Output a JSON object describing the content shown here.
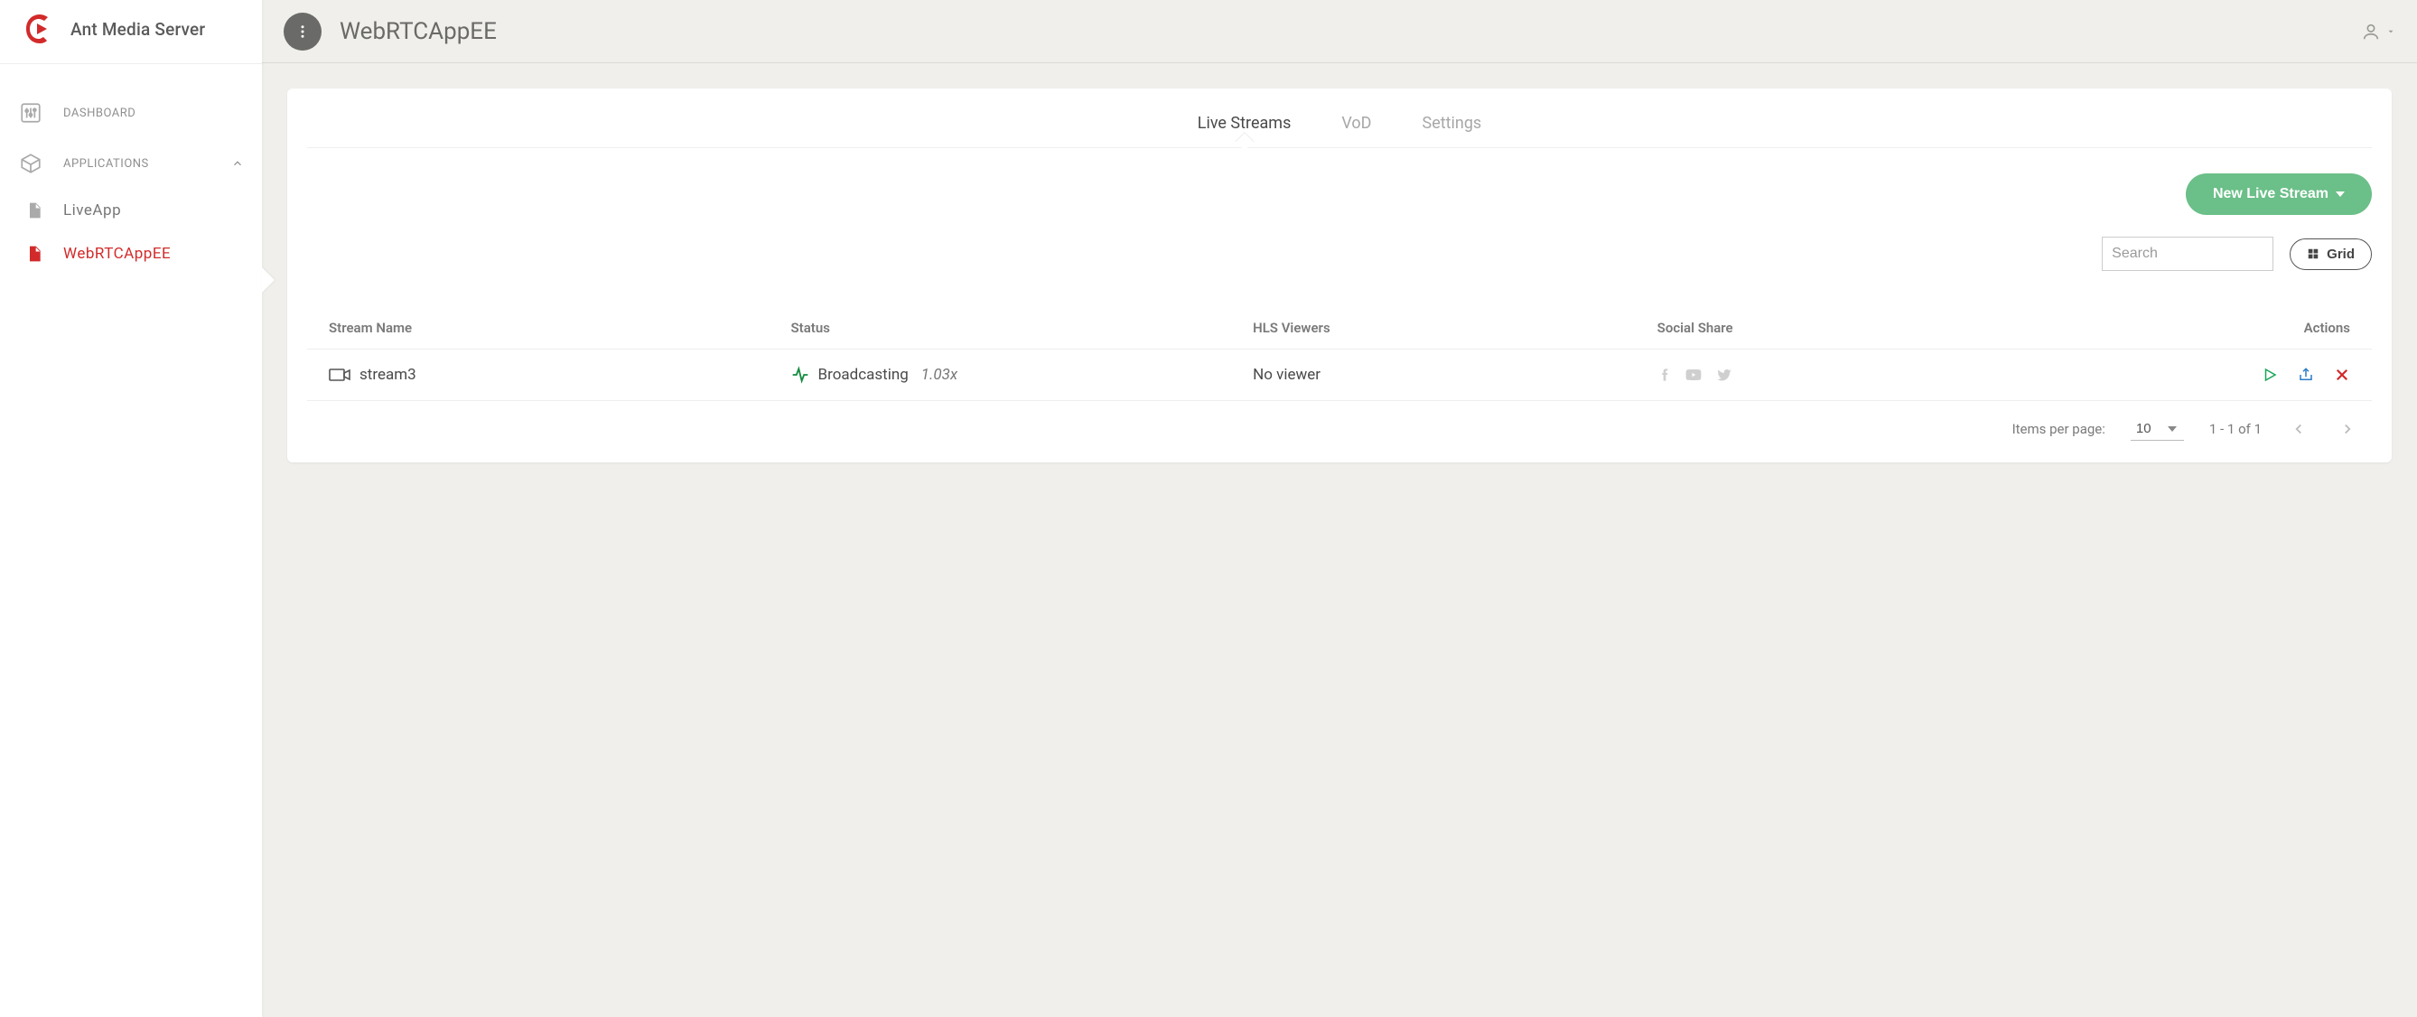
{
  "brand": {
    "title": "Ant Media Server"
  },
  "sidebar": {
    "dashboard_label": "DASHBOARD",
    "applications_label": "APPLICATIONS",
    "apps": [
      {
        "label": "LiveApp"
      },
      {
        "label": "WebRTCAppEE"
      }
    ]
  },
  "header": {
    "page_title": "WebRTCAppEE"
  },
  "tabs": [
    {
      "label": "Live Streams",
      "active": true
    },
    {
      "label": "VoD",
      "active": false
    },
    {
      "label": "Settings",
      "active": false
    }
  ],
  "buttons": {
    "new_live_stream": "New Live Stream",
    "grid": "Grid"
  },
  "search": {
    "placeholder": "Search"
  },
  "table": {
    "headers": {
      "stream_name": "Stream Name",
      "status": "Status",
      "hls_viewers": "HLS Viewers",
      "social_share": "Social Share",
      "actions": "Actions"
    },
    "rows": [
      {
        "name": "stream3",
        "status_text": "Broadcasting",
        "status_speed": "1.03x",
        "viewers": "No viewer"
      }
    ]
  },
  "pager": {
    "items_per_page_label": "Items per page:",
    "items_per_page_value": "10",
    "range_text": "1 - 1 of 1"
  }
}
